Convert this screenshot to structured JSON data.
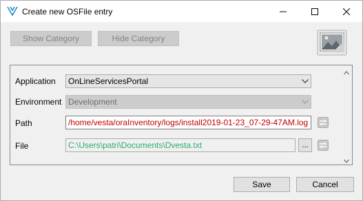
{
  "window": {
    "title": "Create new OSFile entry"
  },
  "toolbar": {
    "show_category_label": "Show Category",
    "hide_category_label": "Hide Category"
  },
  "form": {
    "application": {
      "label": "Application",
      "value": "OnLineServicesPortal"
    },
    "environment": {
      "label": "Environment",
      "value": "Development"
    },
    "path": {
      "label": "Path",
      "value": "/home/vesta/oraInventory/logs/install2019-01-23_07-29-47AM.log",
      "color": "#c00000"
    },
    "file": {
      "label": "File",
      "value": "C:\\Users\\patri\\Documents\\Dvesta.txt",
      "color": "#2eaa6e",
      "browse_label": "..."
    }
  },
  "footer": {
    "save_label": "Save",
    "cancel_label": "Cancel"
  },
  "icons": {
    "app": "vesta-logo-icon",
    "minimize": "minimize-icon",
    "maximize": "maximize-icon",
    "close": "close-icon",
    "picture": "picture-icon",
    "sync": "sync-arrows-icon"
  },
  "colors": {
    "accent": "#1e88c8",
    "path_text": "#c00000",
    "file_text": "#2eaa6e"
  }
}
